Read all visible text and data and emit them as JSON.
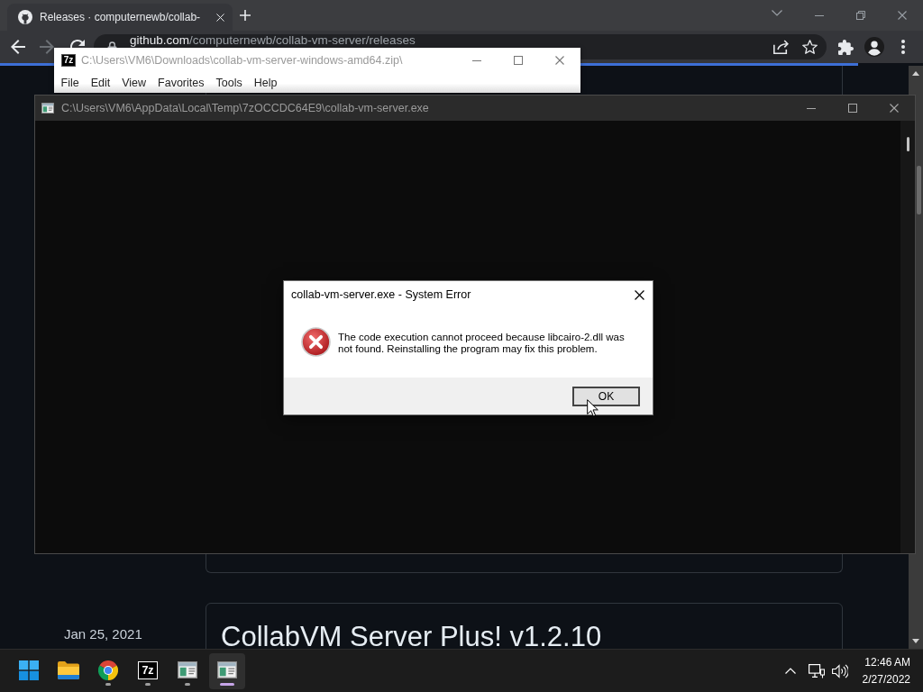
{
  "browser": {
    "tabs": [
      {
        "title": "Releases · computernewb/collab-",
        "selected": true
      }
    ],
    "nav_buttons": [
      {
        "kind": "back",
        "disabled": false
      },
      {
        "kind": "forward",
        "disabled": true
      },
      {
        "kind": "reload",
        "disabled": false
      }
    ],
    "address": {
      "host": "github.com",
      "path": "/computernewb/collab-vm-server/releases"
    },
    "load_progress": {
      "level": 0.93
    },
    "page": {
      "releases": [
        {
          "date": "Jan 25, 2021",
          "title": "CollabVM Server Plus! v1.2.10"
        }
      ]
    }
  },
  "archive_window": {
    "logo": "7z",
    "title": "C:\\Users\\VM6\\Downloads\\collab-vm-server-windows-amd64.zip\\",
    "active": false,
    "menu": [
      "File",
      "Edit",
      "View",
      "Favorites",
      "Tools",
      "Help"
    ]
  },
  "console_window": {
    "title": "C:\\Users\\VM6\\AppData\\Local\\Temp\\7zOCCDC64E9\\collab-vm-server.exe",
    "active": false
  },
  "error_dialog": {
    "title": "collab-vm-server.exe - System Error",
    "active": true,
    "kind": "error",
    "message": "The code execution cannot proceed because libcairo-2.dll was not found. Reinstalling the program may fix this problem.",
    "buttons": [
      "OK"
    ]
  },
  "taskbar": {
    "apps": [
      {
        "kind": "start",
        "running": false,
        "selected": false
      },
      {
        "kind": "explorer",
        "running": false,
        "selected": false
      },
      {
        "kind": "browser",
        "running": true,
        "selected": false
      },
      {
        "kind": "archiver",
        "label": "7z",
        "running": true,
        "selected": false
      },
      {
        "kind": "console",
        "running": true,
        "selected": false
      },
      {
        "kind": "console",
        "running": true,
        "selected": true
      }
    ],
    "clock": {
      "time": "12:46 AM",
      "date": "2/27/2022"
    }
  }
}
